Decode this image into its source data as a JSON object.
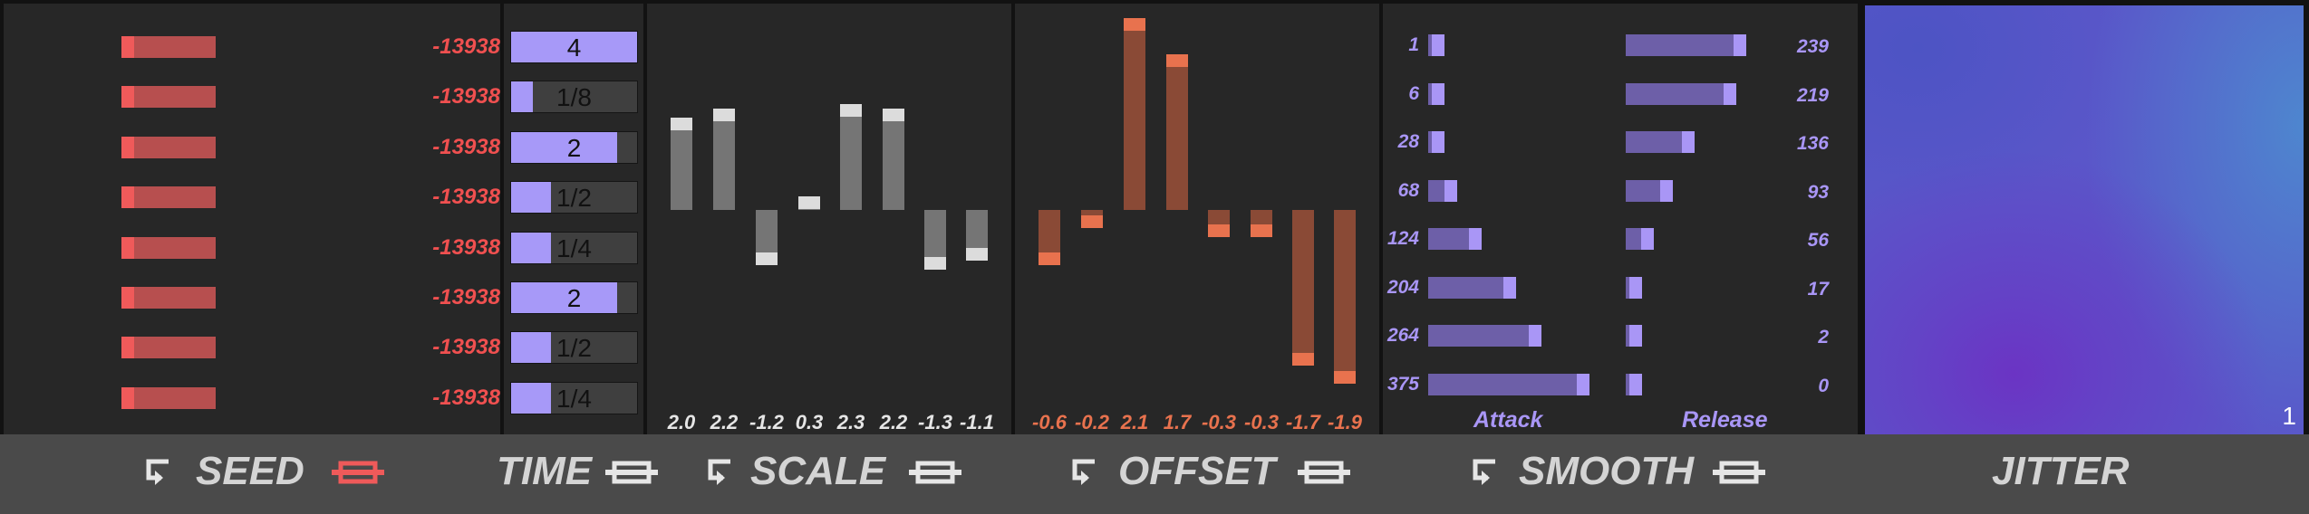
{
  "seed": {
    "values": [
      "-13938",
      "-13938",
      "-13938",
      "-13938",
      "-13938",
      "-13938",
      "-13938",
      "-13938"
    ],
    "footer_label": "SEED",
    "loop_icon": "loop-arrow-icon",
    "link_icon": "link-icon",
    "link_color": "#ef5a5a"
  },
  "time": {
    "items": [
      {
        "label": "4",
        "fill": 1.0
      },
      {
        "label": "1/8",
        "fill": 0.17
      },
      {
        "label": "2",
        "fill": 0.84
      },
      {
        "label": "1/2",
        "fill": 0.32
      },
      {
        "label": "1/4",
        "fill": 0.32
      },
      {
        "label": "2",
        "fill": 0.84
      },
      {
        "label": "1/2",
        "fill": 0.32
      },
      {
        "label": "1/4",
        "fill": 0.32
      }
    ],
    "footer_label": "TIME",
    "link_icon": "link-icon"
  },
  "scale": {
    "values": [
      "2.0",
      "2.2",
      "-1.2",
      "0.3",
      "2.3",
      "2.2",
      "-1.3",
      "-1.1"
    ],
    "footer_label": "SCALE",
    "range": [
      -2.5,
      2.5
    ],
    "bar_color": "#757575",
    "cap_color": "#dcdcdc"
  },
  "offset": {
    "values": [
      "-0.6",
      "-0.2",
      "2.1",
      "1.7",
      "-0.3",
      "-0.3",
      "-1.7",
      "-1.9"
    ],
    "footer_label": "OFFSET",
    "range": [
      -2.0,
      2.2
    ],
    "bar_color": "#8a4a36",
    "cap_color": "#e8724e",
    "label_color": "#e8724e"
  },
  "smooth": {
    "attack": [
      "1",
      "6",
      "28",
      "68",
      "124",
      "204",
      "264",
      "375"
    ],
    "release": [
      "239",
      "219",
      "136",
      "93",
      "56",
      "17",
      "2",
      "0"
    ],
    "attack_label": "Attack",
    "release_label": "Release",
    "footer_label": "SMOOTH",
    "max": 400
  },
  "jitter": {
    "footer_label": "JITTER",
    "corner_value": "1"
  },
  "colors": {
    "panel": "#272727",
    "accent_purple": "#a996f6",
    "seed_red": "#f05050"
  }
}
